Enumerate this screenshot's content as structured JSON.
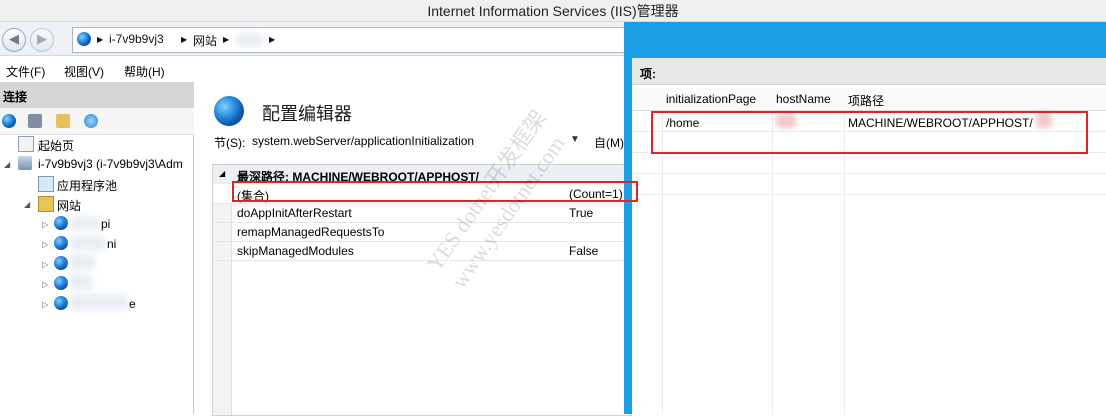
{
  "window": {
    "title": "Internet Information Services (IIS)管理器"
  },
  "address_bar": {
    "crumbs": [
      "i-7v9b9vj3",
      "网站"
    ]
  },
  "menubar": {
    "items": [
      "文件(F)",
      "视图(V)",
      "帮助(H)"
    ]
  },
  "connections": {
    "header": "连接",
    "tree": {
      "start_page": "起始页",
      "server": "i-7v9b9vj3 (i-7v9b9vj3\\Adm",
      "app_pools": "应用程序池",
      "sites": "网站",
      "site_suffixes": [
        "pi",
        "ni",
        "",
        "",
        "e"
      ]
    }
  },
  "config_editor": {
    "title": "配置编辑器",
    "section_label": "节(S):",
    "section_value": "system.webServer/applicationInitialization",
    "from_label": "自(M)",
    "grid": {
      "header": "最深路径: MACHINE/WEBROOT/APPHOST/",
      "rows": [
        {
          "name": "(集合)",
          "value": "(Count=1)"
        },
        {
          "name": "doAppInitAfterRestart",
          "value": "True"
        },
        {
          "name": "remapManagedRequestsTo",
          "value": ""
        },
        {
          "name": "skipManagedModules",
          "value": "False"
        }
      ]
    }
  },
  "collection_editor": {
    "items_label": "项:",
    "columns": [
      "initializationPage",
      "hostName",
      "项路径"
    ],
    "rows": [
      {
        "initializationPage": "/home",
        "hostName": "",
        "path": "MACHINE/WEBROOT/APPHOST/"
      }
    ]
  },
  "watermark": {
    "line1": "YES dotnet开发框架",
    "line2": "www.yesdotnet.com"
  },
  "colors": {
    "accent_blue": "#1a9ee6",
    "annotation_red": "#e02424"
  }
}
